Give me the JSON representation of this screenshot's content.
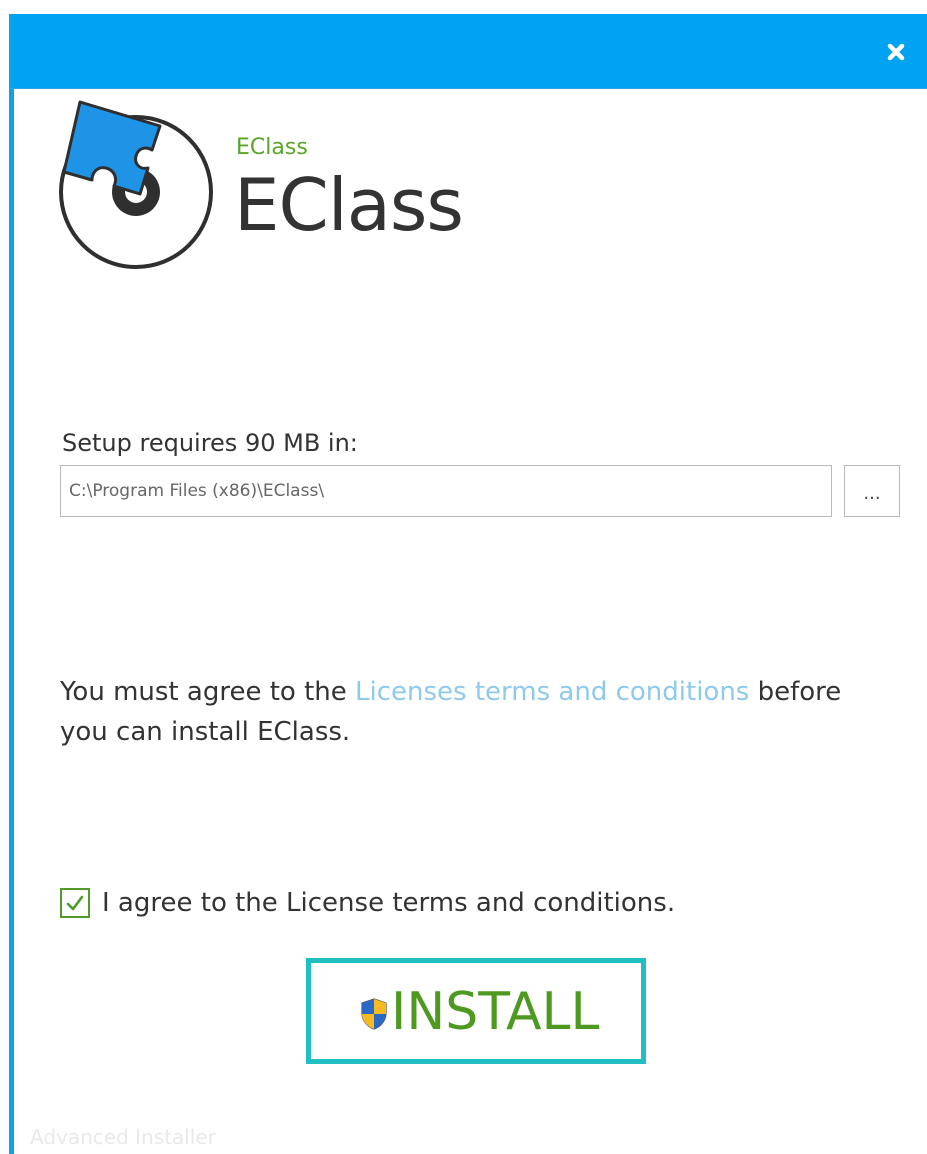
{
  "window": {
    "close_label": "×",
    "accent_color": "#00a2f2"
  },
  "branding": {
    "small_name": "EClass",
    "large_name": "EClass",
    "logo_icon": "puzzle-disc-logo"
  },
  "location": {
    "requirement_label": "Setup requires 90 MB in:",
    "install_path": "C:\\Program Files (x86)\\EClass\\",
    "browse_label": "..."
  },
  "license": {
    "text_before": "You must agree to the ",
    "link_text": "Licenses terms and conditions",
    "text_after": " before you can install EClass.",
    "checkbox_label": "I agree to the License terms and conditions.",
    "checkbox_checked": true
  },
  "install_button": {
    "label": "INSTALL",
    "icon": "uac-shield-icon"
  },
  "footer": {
    "brand": "Advanced Installer"
  }
}
